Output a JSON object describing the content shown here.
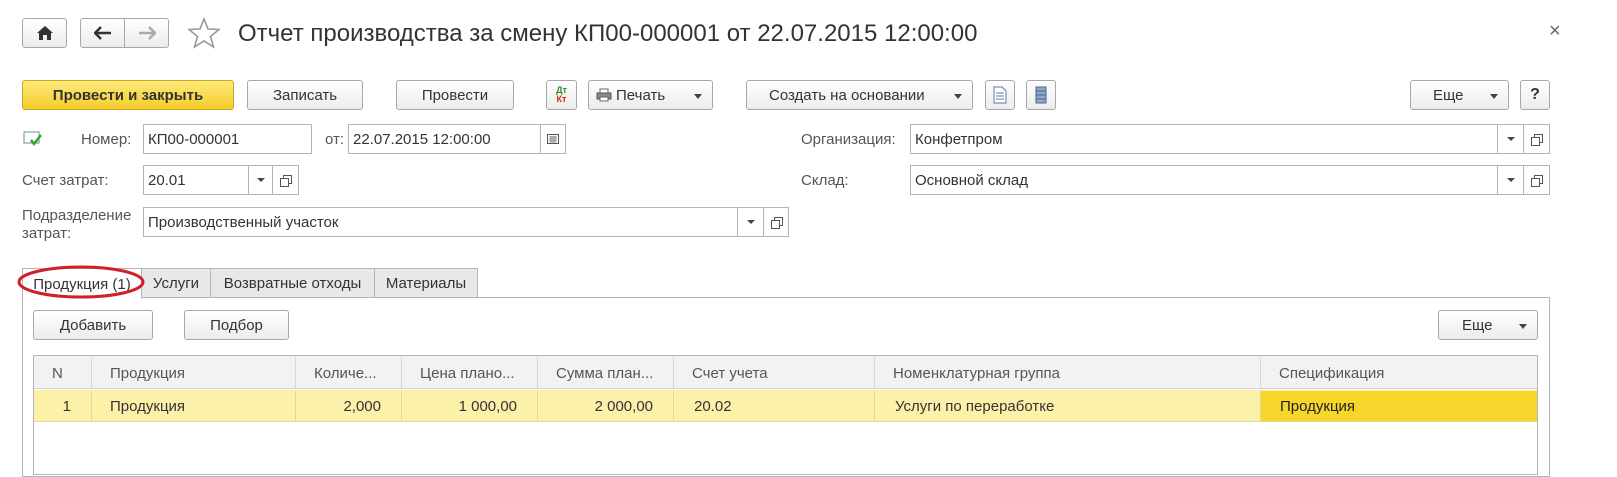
{
  "window": {
    "title": "Отчет производства за смену КП00-000001 от 22.07.2015 12:00:00",
    "close_glyph": "×"
  },
  "toolbar": {
    "post_and_close": "Провести и закрыть",
    "save": "Записать",
    "post": "Провести",
    "dt_kt_top": "Дт",
    "dt_kt_bottom": "Кт",
    "print": "Печать",
    "create_based_on": "Создать на основании",
    "more": "Еще",
    "help": "?"
  },
  "form": {
    "number_label": "Номер:",
    "number_value": "КП00-000001",
    "date_label": "от:",
    "date_value": "22.07.2015 12:00:00",
    "organization_label": "Организация:",
    "organization_value": "Конфетпром",
    "cost_account_label": "Счет затрат:",
    "cost_account_value": "20.01",
    "warehouse_label": "Склад:",
    "warehouse_value": "Основной склад",
    "division_label_line1": "Подразделение",
    "division_label_line2": "затрат:",
    "division_value": "Производственный участок"
  },
  "tabs": [
    {
      "label": "Продукция (1)",
      "active": true
    },
    {
      "label": "Услуги",
      "active": false
    },
    {
      "label": "Возвратные отходы",
      "active": false
    },
    {
      "label": "Материалы",
      "active": false
    }
  ],
  "table_toolbar": {
    "add": "Добавить",
    "select": "Подбор",
    "more": "Еще"
  },
  "table": {
    "columns": [
      "N",
      "Продукция",
      "Количе...",
      "Цена плано...",
      "Сумма план...",
      "Счет учета",
      "Номенклатурная группа",
      "Спецификация"
    ],
    "rows": [
      [
        "1",
        "Продукция",
        "2,000",
        "1 000,00",
        "2 000,00",
        "20.02",
        "Услуги по переработке",
        "Продукция"
      ]
    ]
  },
  "colors": {
    "primary_button": "#f5cc2a",
    "selected_row": "#fbf1a9",
    "selected_cell": "#f7d52a",
    "highlight_ellipse": "#d0202a"
  }
}
